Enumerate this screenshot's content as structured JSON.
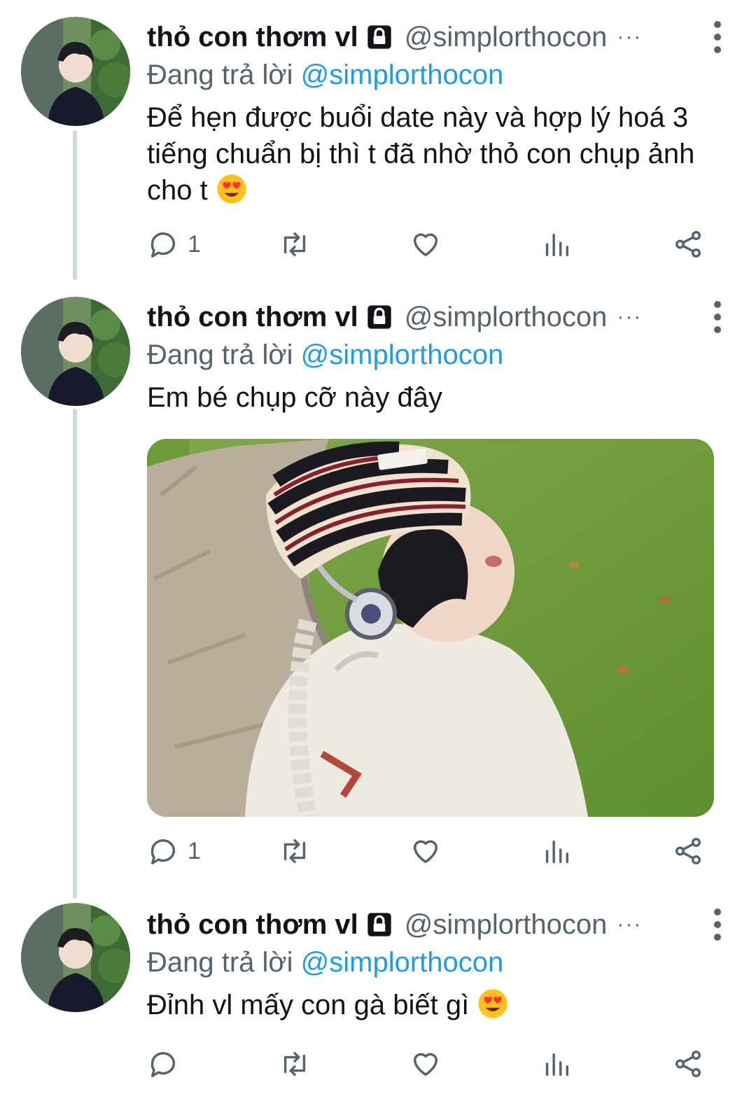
{
  "tweets": [
    {
      "name": "thỏ con thơm vl",
      "handle": "@simplorthocon",
      "dots": "···",
      "reply_prefix": "Đang trả lời",
      "reply_mention": "@simplorthocon",
      "text": "Để hẹn được buổi date này và hợp lý hoá 3 tiếng chuẩn bị thì t đã nhờ thỏ con chụp ảnh cho t",
      "emoji": "smiling-face-with-heart-eyes",
      "reply_count": "1",
      "retweet_count": "",
      "like_count": ""
    },
    {
      "name": "thỏ con thơm vl",
      "handle": "@simplorthocon",
      "dots": "···",
      "reply_prefix": "Đang trả lời",
      "reply_mention": "@simplorthocon",
      "text": "Em bé chụp cỡ này đây",
      "reply_count": "1",
      "retweet_count": "",
      "like_count": ""
    },
    {
      "name": "thỏ con thơm vl",
      "handle": "@simplorthocon",
      "dots": "···",
      "reply_prefix": "Đang trả lời",
      "reply_mention": "@simplorthocon",
      "text": "Đỉnh vl mấy con gà biết gì",
      "emoji": "smiling-face-with-heart-eyes",
      "reply_count": "",
      "retweet_count": "",
      "like_count": ""
    }
  ],
  "icons": {
    "reply": "reply-icon",
    "retweet": "retweet-icon",
    "like": "heart-icon",
    "views": "analytics-icon",
    "share": "share-icon",
    "lock": "lock-icon",
    "more": "more-vertical-icon"
  },
  "colors": {
    "text": "#0f1419",
    "secondary": "#536471",
    "accent": "#1d9bf0",
    "thread_line": "#cfd9de"
  }
}
